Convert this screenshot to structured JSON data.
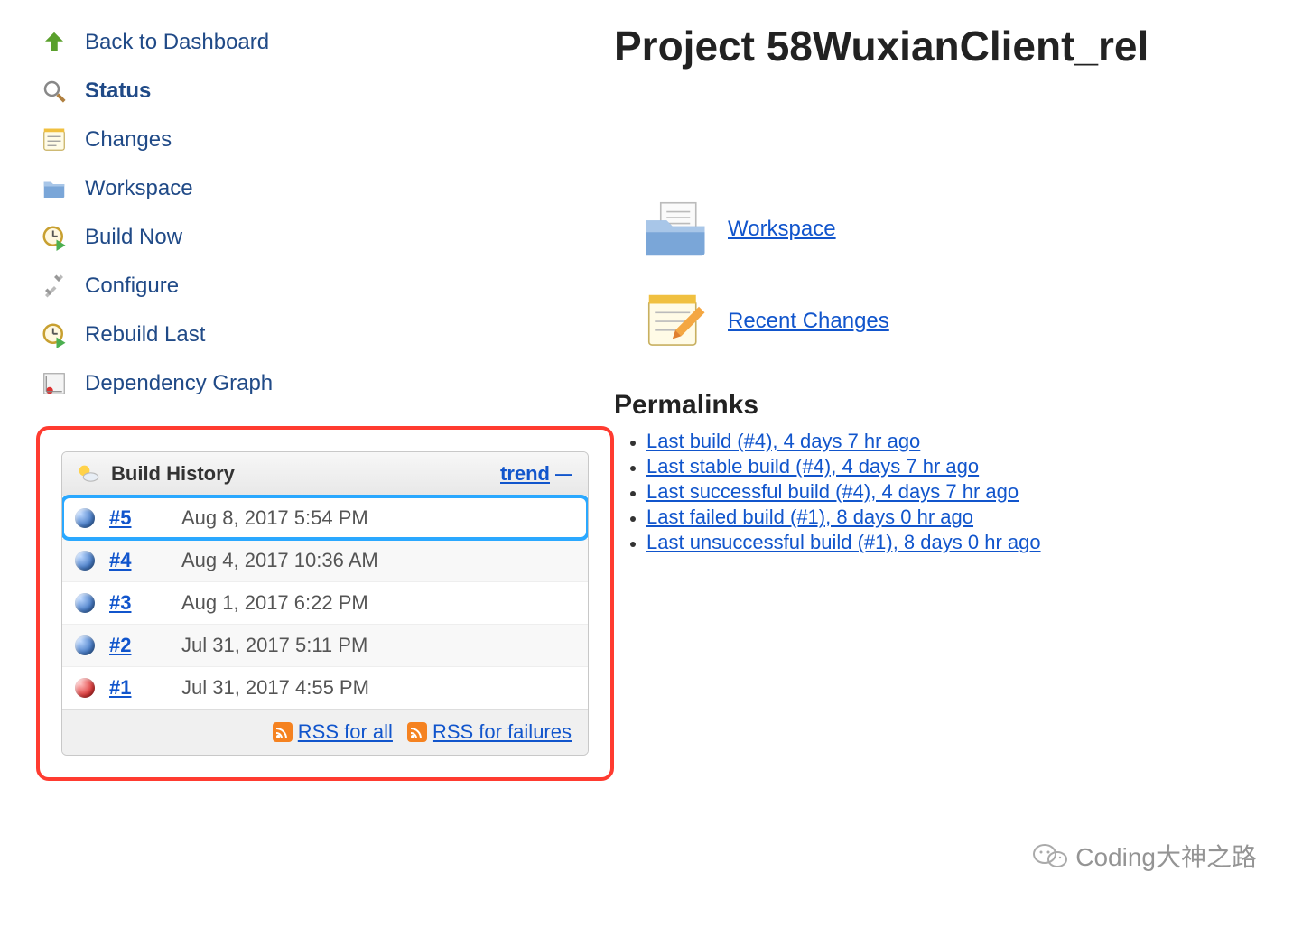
{
  "sidebar": {
    "items": [
      {
        "label": "Back to Dashboard",
        "active": false
      },
      {
        "label": "Status",
        "active": true
      },
      {
        "label": "Changes",
        "active": false
      },
      {
        "label": "Workspace",
        "active": false
      },
      {
        "label": "Build Now",
        "active": false
      },
      {
        "label": "Configure",
        "active": false
      },
      {
        "label": "Rebuild Last",
        "active": false
      },
      {
        "label": "Dependency Graph",
        "active": false
      }
    ]
  },
  "buildHistory": {
    "title": "Build History",
    "trend": "trend",
    "rows": [
      {
        "num": "#5",
        "time": "Aug 8, 2017 5:54 PM",
        "status": "blue",
        "highlight": true
      },
      {
        "num": "#4",
        "time": "Aug 4, 2017 10:36 AM",
        "status": "blue",
        "highlight": false
      },
      {
        "num": "#3",
        "time": "Aug 1, 2017 6:22 PM",
        "status": "blue",
        "highlight": false
      },
      {
        "num": "#2",
        "time": "Jul 31, 2017 5:11 PM",
        "status": "blue",
        "highlight": false
      },
      {
        "num": "#1",
        "time": "Jul 31, 2017 4:55 PM",
        "status": "red",
        "highlight": false
      }
    ],
    "rssAll": "RSS for all",
    "rssFailures": "RSS for failures"
  },
  "main": {
    "title": "Project 58WuxianClient_rel",
    "workspace": "Workspace",
    "recentChanges": "Recent Changes",
    "permalinksHeading": "Permalinks",
    "permalinks": [
      "Last build (#4), 4 days 7 hr ago",
      "Last stable build (#4), 4 days 7 hr ago",
      "Last successful build (#4), 4 days 7 hr ago",
      "Last failed build (#1), 8 days 0 hr ago",
      "Last unsuccessful build (#1), 8 days 0 hr ago"
    ]
  },
  "watermark": "Coding大神之路"
}
